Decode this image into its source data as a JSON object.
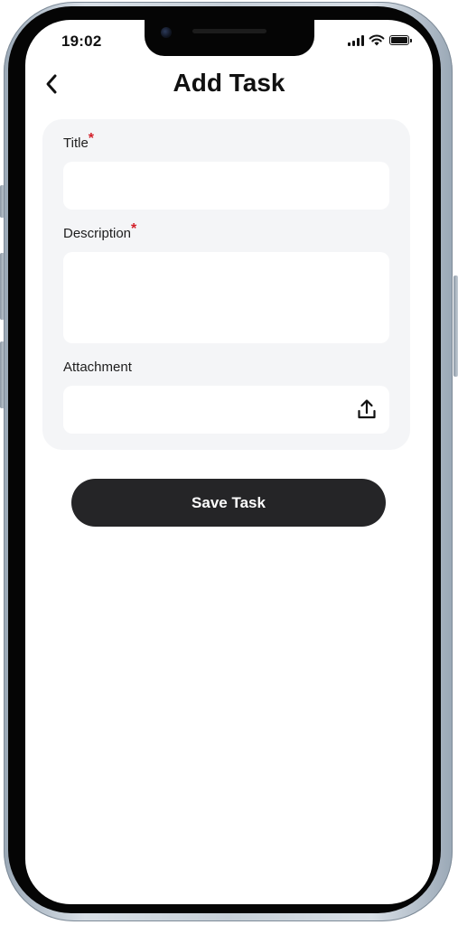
{
  "status_bar": {
    "time": "19:02",
    "icons": [
      "cellular-signal-icon",
      "wifi-icon",
      "battery-icon"
    ],
    "battery_level": 1.0
  },
  "header": {
    "back_icon": "chevron-left-icon",
    "title": "Add Task"
  },
  "form": {
    "title_field": {
      "label": "Title",
      "required_marker": "*",
      "value": ""
    },
    "description_field": {
      "label": "Description",
      "required_marker": "*",
      "value": ""
    },
    "attachment_field": {
      "label": "Attachment",
      "value": "",
      "icon": "upload-icon"
    }
  },
  "actions": {
    "save_label": "Save Task"
  },
  "colors": {
    "primary_button": "#252527",
    "required_marker": "#d3202a",
    "card_background": "#f4f5f7",
    "text": "#111111"
  }
}
